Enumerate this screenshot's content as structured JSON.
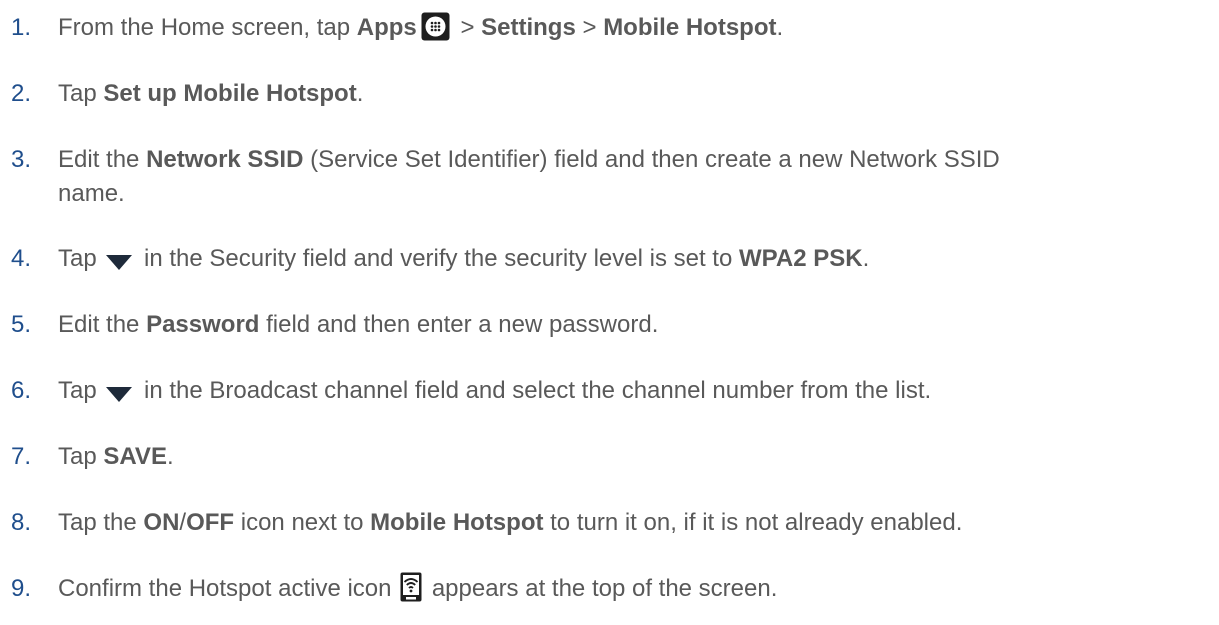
{
  "colors": {
    "text": "#595959",
    "number": "#1f4e8c"
  },
  "steps": [
    {
      "num": "1.",
      "t1": "From the Home screen, tap ",
      "b1": "Apps",
      "icon": "apps-icon",
      "t2": " > ",
      "b2": "Settings",
      "t3": " > ",
      "b3": "Mobile Hotspot",
      "t4": "."
    },
    {
      "num": "2.",
      "t1": "Tap ",
      "b1": "Set up Mobile Hotspot",
      "t2": "."
    },
    {
      "num": "3.",
      "t1": "Edit the ",
      "b1": "Network SSID",
      "t2": " (Service Set Identifier) field and then create a new Network SSID",
      "t3": "name."
    },
    {
      "num": "4.",
      "t1": "Tap ",
      "icon": "dropdown-triangle-icon",
      "t2": " in the Security field and verify the security level is set to ",
      "b1": "WPA2 PSK",
      "t3": "."
    },
    {
      "num": "5.",
      "t1": "Edit the ",
      "b1": "Password",
      "t2": " field and then enter a new password."
    },
    {
      "num": "6.",
      "t1": "Tap ",
      "icon": "dropdown-triangle-icon",
      "t2": " in the Broadcast channel field and select the channel number from the list."
    },
    {
      "num": "7.",
      "t1": "Tap ",
      "b1": "SAVE",
      "t2": "."
    },
    {
      "num": "8.",
      "t1": "Tap the ",
      "b1": "ON",
      "t2": "/",
      "b2": "OFF",
      "t3": " icon next to ",
      "b3": "Mobile Hotspot",
      "t4": " to turn it on, if it is not already enabled."
    },
    {
      "num": "9.",
      "t1": "Confirm the Hotspot active icon ",
      "icon": "hotspot-active-icon",
      "t2": " appears at the top of the screen."
    }
  ]
}
